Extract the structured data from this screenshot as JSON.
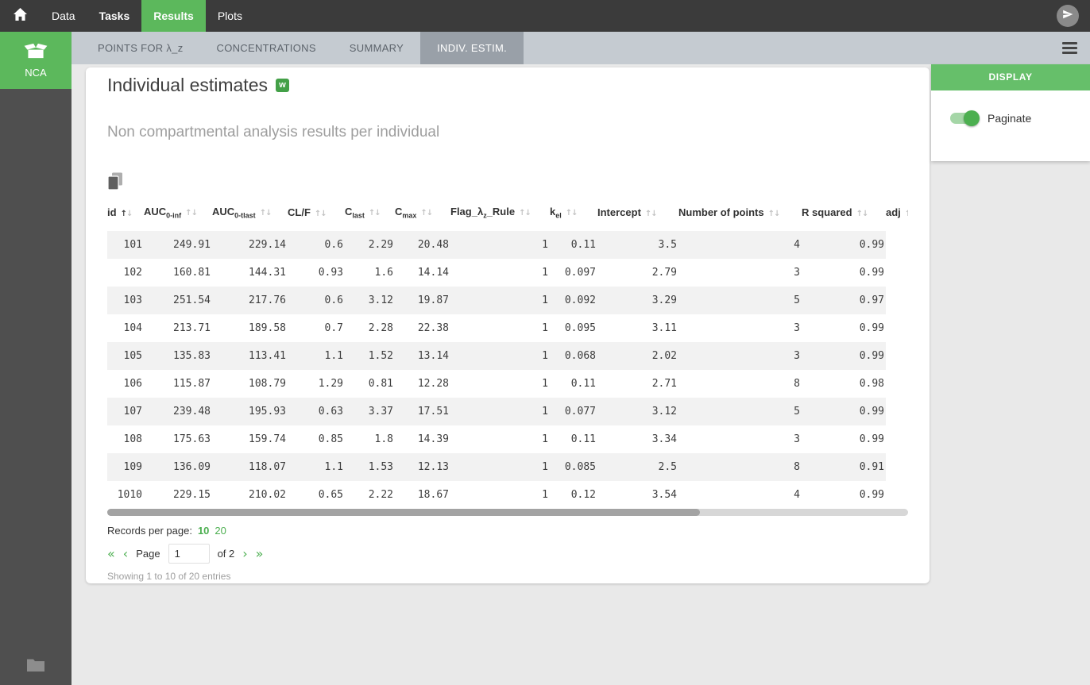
{
  "colors": {
    "green_nav": "#5cb85c",
    "green_accent": "#4caf50",
    "green_panel_header": "#66bf6a",
    "topnav_bg": "#3b3b3b",
    "sidebar_bg": "#4f4f4f",
    "tabbar_bg": "#c5cbd1",
    "tab_active_bg": "#99a0a8",
    "row_stripe": "#f2f2f2"
  },
  "topnav": {
    "items": [
      {
        "label": "Data",
        "active": false
      },
      {
        "label": "Tasks",
        "active": false
      },
      {
        "label": "Results",
        "active": true
      },
      {
        "label": "Plots",
        "active": false
      }
    ]
  },
  "sidebar": {
    "module": "NCA"
  },
  "tabbar": {
    "tabs": [
      {
        "label": "POINTS FOR λ_z",
        "active": false
      },
      {
        "label": "CONCENTRATIONS",
        "active": false
      },
      {
        "label": "SUMMARY",
        "active": false
      },
      {
        "label": "INDIV. ESTIM.",
        "active": true
      }
    ]
  },
  "card": {
    "title": "Individual estimates",
    "export_icon_label": "w",
    "subtitle": "Non compartmental analysis results per individual"
  },
  "table": {
    "headers": [
      {
        "key": "id",
        "pre": "id",
        "sub": "",
        "post": "",
        "sorted": "asc"
      },
      {
        "key": "auc-0-inf",
        "pre": "AUC",
        "sub": "0-inf",
        "post": ""
      },
      {
        "key": "auc-0-tlast",
        "pre": "AUC",
        "sub": "0-tlast",
        "post": ""
      },
      {
        "key": "cl-f",
        "pre": "CL/F",
        "sub": "",
        "post": ""
      },
      {
        "key": "c-last",
        "pre": "C",
        "sub": "last",
        "post": ""
      },
      {
        "key": "c-max",
        "pre": "C",
        "sub": "max",
        "post": ""
      },
      {
        "key": "flag-lambda-z-rule",
        "pre": "Flag_λ",
        "sub": "z",
        "post": "_Rule"
      },
      {
        "key": "k-el",
        "pre": "k",
        "sub": "el",
        "post": ""
      },
      {
        "key": "intercept",
        "pre": "Intercept",
        "sub": "",
        "post": ""
      },
      {
        "key": "number-of-points",
        "pre": "Number of points",
        "sub": "",
        "post": ""
      },
      {
        "key": "r-squared",
        "pre": "R squared",
        "sub": "",
        "post": ""
      },
      {
        "key": "adj",
        "pre": "adj",
        "sub": "",
        "post": ""
      }
    ],
    "rows": [
      [
        "101",
        "249.91",
        "229.14",
        "0.6",
        "2.29",
        "20.48",
        "1",
        "0.11",
        "3.5",
        "4",
        "0.99"
      ],
      [
        "102",
        "160.81",
        "144.31",
        "0.93",
        "1.6",
        "14.14",
        "1",
        "0.097",
        "2.79",
        "3",
        "0.99"
      ],
      [
        "103",
        "251.54",
        "217.76",
        "0.6",
        "3.12",
        "19.87",
        "1",
        "0.092",
        "3.29",
        "5",
        "0.97"
      ],
      [
        "104",
        "213.71",
        "189.58",
        "0.7",
        "2.28",
        "22.38",
        "1",
        "0.095",
        "3.11",
        "3",
        "0.99"
      ],
      [
        "105",
        "135.83",
        "113.41",
        "1.1",
        "1.52",
        "13.14",
        "1",
        "0.068",
        "2.02",
        "3",
        "0.99"
      ],
      [
        "106",
        "115.87",
        "108.79",
        "1.29",
        "0.81",
        "12.28",
        "1",
        "0.11",
        "2.71",
        "8",
        "0.98"
      ],
      [
        "107",
        "239.48",
        "195.93",
        "0.63",
        "3.37",
        "17.51",
        "1",
        "0.077",
        "3.12",
        "5",
        "0.99"
      ],
      [
        "108",
        "175.63",
        "159.74",
        "0.85",
        "1.8",
        "14.39",
        "1",
        "0.11",
        "3.34",
        "3",
        "0.99"
      ],
      [
        "109",
        "136.09",
        "118.07",
        "1.1",
        "1.53",
        "12.13",
        "1",
        "0.085",
        "2.5",
        "8",
        "0.91"
      ],
      [
        "1010",
        "229.15",
        "210.02",
        "0.65",
        "2.22",
        "18.67",
        "1",
        "0.12",
        "3.54",
        "4",
        "0.99"
      ]
    ]
  },
  "footer": {
    "records_label": "Records per page:",
    "page_sizes": [
      "10",
      "20"
    ],
    "selected_size": "10",
    "icons": {
      "first": "«",
      "prev": "‹",
      "next": "›",
      "last": "»"
    },
    "page_label": "Page",
    "page_value": "1",
    "of_label": "of 2",
    "showing": "Showing 1 to 10 of 20 entries"
  },
  "display_panel": {
    "title": "DISPLAY",
    "toggle_label": "Paginate",
    "toggle_on": true
  }
}
